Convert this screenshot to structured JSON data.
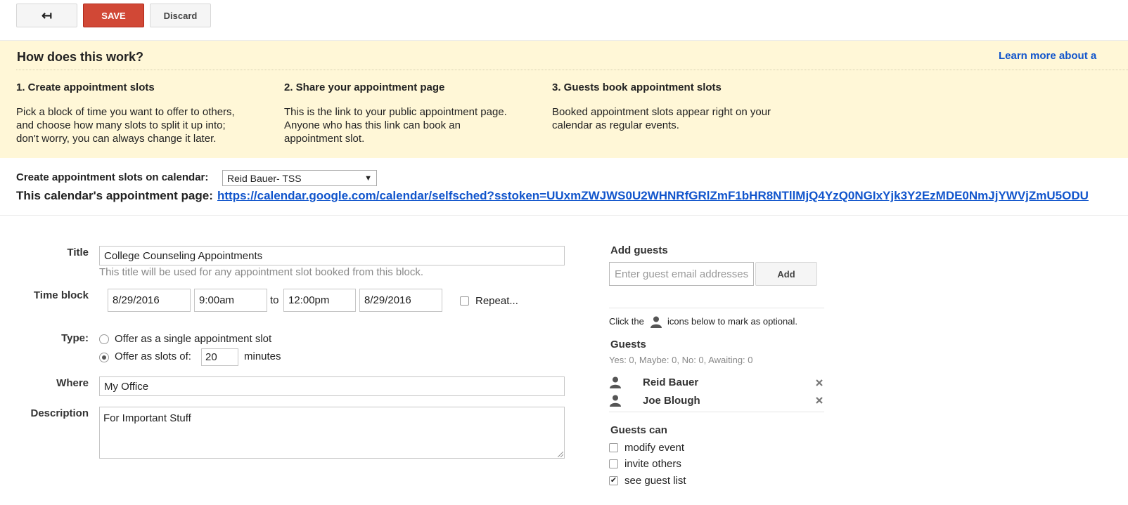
{
  "toolbar": {
    "back_glyph": "↤",
    "save_label": "SAVE",
    "discard_label": "Discard"
  },
  "banner": {
    "title": "How does this work?",
    "learn_more": "Learn more about a",
    "steps": [
      {
        "heading": "1. Create appointment slots",
        "text": "Pick a block of time you want to offer to others,\nand choose how many slots to split it up into;\ndon't worry, you can always change it later."
      },
      {
        "heading": "2. Share your appointment page",
        "text": "This is the link to your public appointment page.\nAnyone who has this link can book an\nappointment slot."
      },
      {
        "heading": "3. Guests book appointment slots",
        "text": "Booked appointment slots appear right on your\ncalendar as regular events."
      }
    ]
  },
  "calendar": {
    "label": "Create appointment slots on calendar:",
    "selected": "Reid Bauer- TSS",
    "page_label": "This calendar's appointment page:",
    "page_url": "https://calendar.google.com/calendar/selfsched?sstoken=UUxmZWJWS0U2WHNRfGRlZmF1bHR8NTllMjQ4YzQ0NGIxYjk3Y2EzMDE0NmJjYWVjZmU5ODU"
  },
  "form": {
    "title_label": "Title",
    "title_value": "College Counseling Appointments",
    "title_hint": "This title will be used for any appointment slot booked from this block.",
    "time_label": "Time block",
    "start_date": "8/29/2016",
    "start_time": "9:00am",
    "to_label": "to",
    "end_time": "12:00pm",
    "end_date": "8/29/2016",
    "repeat_label": "Repeat...",
    "repeat_checked": false,
    "type_label": "Type:",
    "type_single": "Offer as a single appointment slot",
    "type_slots": "Offer as slots of:",
    "slot_minutes": "20",
    "minutes_label": "minutes",
    "type_selected": "slots",
    "where_label": "Where",
    "where_value": "My Office",
    "description_label": "Description",
    "description_value": "For Important Stuff"
  },
  "guests": {
    "add_heading": "Add guests",
    "input_placeholder": "Enter guest email addresses",
    "add_label": "Add",
    "hint_before": "Click the",
    "hint_after": "icons below to mark as optional.",
    "guests_heading": "Guests",
    "rsvp_summary": "Yes: 0, Maybe: 0, No: 0, Awaiting: 0",
    "list": [
      {
        "name": "Reid Bauer"
      },
      {
        "name": "Joe Blough"
      }
    ],
    "can_heading": "Guests can",
    "permissions": [
      {
        "label": "modify event",
        "checked": false
      },
      {
        "label": "invite others",
        "checked": false
      },
      {
        "label": "see guest list",
        "checked": true
      }
    ]
  },
  "colors": {
    "save_button": "#d14836",
    "banner_bg": "#fff7d7",
    "link": "#1155cc"
  },
  "icons": {
    "back": "back-arrow-icon",
    "person": "person-icon",
    "remove": "close-icon",
    "dropdown": "caret-down-icon"
  }
}
